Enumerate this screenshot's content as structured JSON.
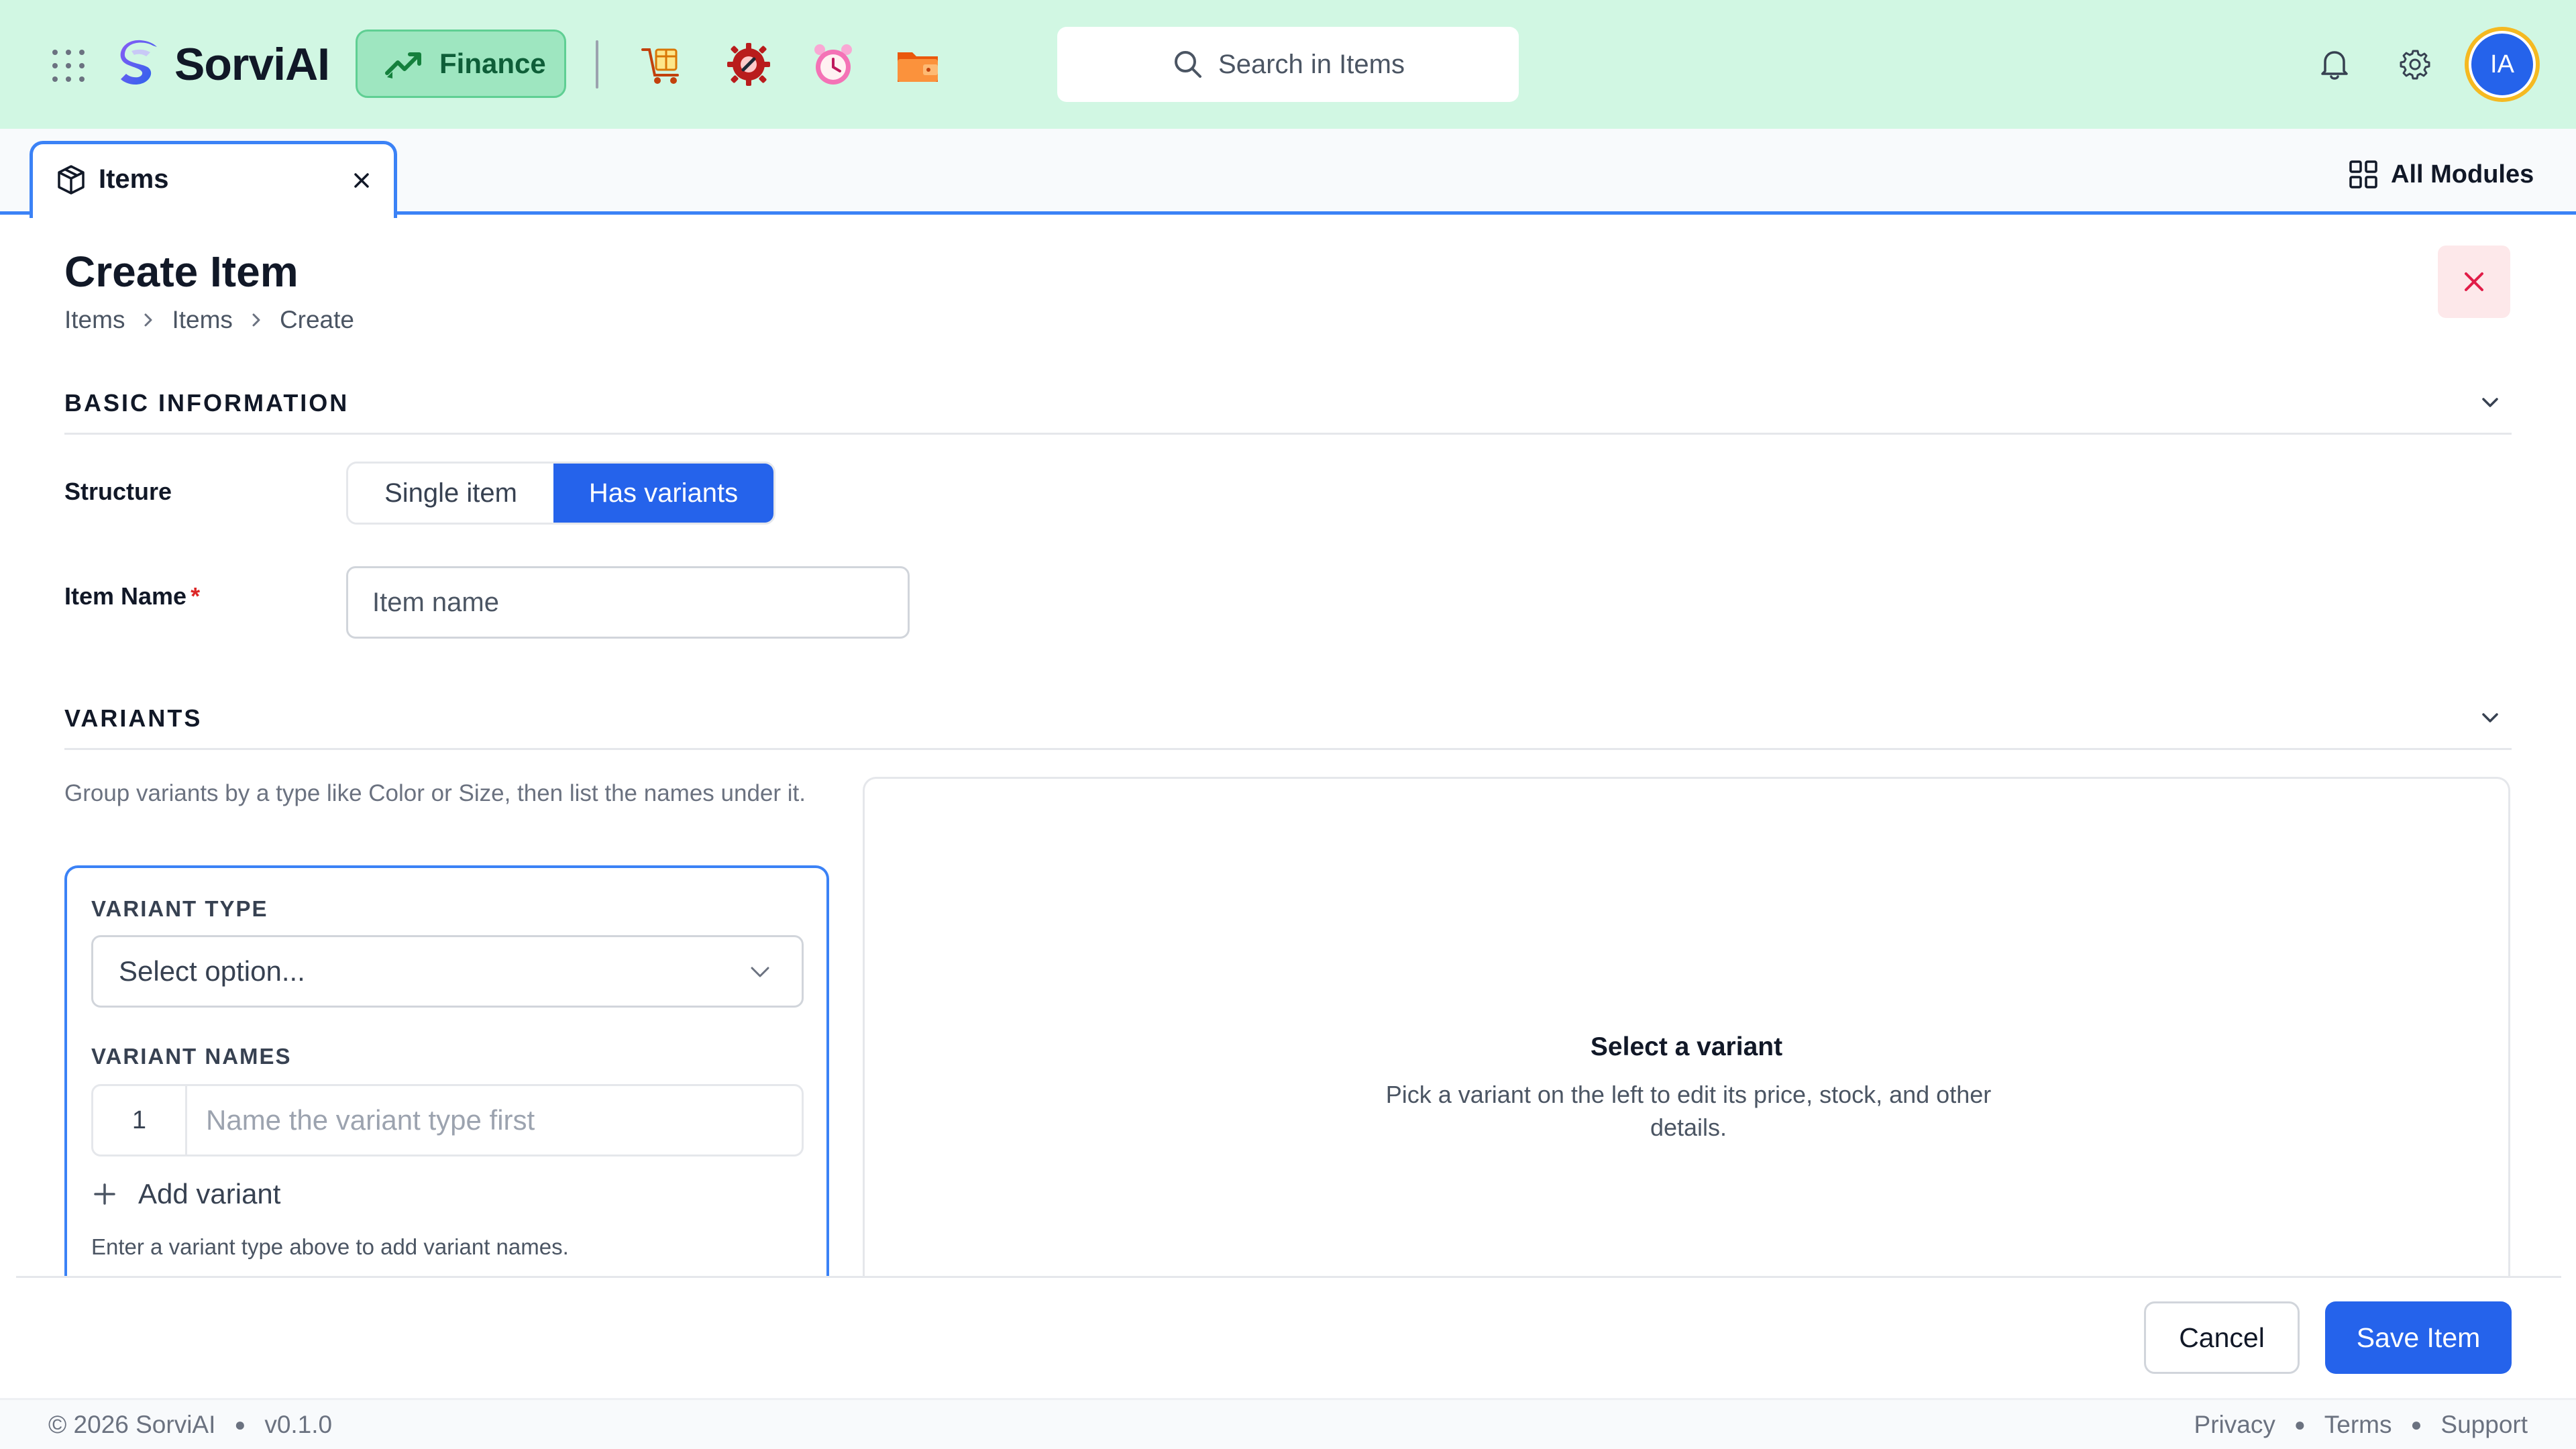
{
  "header": {
    "brand": "SorviAI",
    "module": "Finance",
    "search_placeholder": "Search in Items",
    "avatar_initials": "IA",
    "colors": {
      "bg": "#d1f7e3",
      "chip": "#9ee6c0",
      "accent": "#2563eb",
      "ring": "#f5b921"
    },
    "app_icons": [
      "shopping-cart-box-icon",
      "settings-gear-icon",
      "alarm-clock-icon",
      "wallet-folder-icon"
    ]
  },
  "tabs": {
    "active_label": "Items",
    "all_modules": "All Modules"
  },
  "page": {
    "title": "Create Item",
    "breadcrumb": [
      "Items",
      "Items",
      "Create"
    ]
  },
  "basic": {
    "heading": "BASIC INFORMATION",
    "structure_label": "Structure",
    "structure_options": [
      "Single item",
      "Has variants"
    ],
    "structure_selected": "Has variants",
    "name_label": "Item Name",
    "required_mark": "*",
    "name_placeholder": "Item name"
  },
  "variants": {
    "heading": "VARIANTS",
    "helper": "Group variants by a type like Color or Size, then list the names under it.",
    "type_label": "VARIANT TYPE",
    "type_placeholder": "Select option...",
    "names_label": "VARIANT NAMES",
    "row_number": "1",
    "row_placeholder": "Name the variant type first",
    "add_label": "Add variant",
    "hint": "Enter a variant type above to add variant names.",
    "empty_title": "Select a variant",
    "empty_desc": "Pick a variant on the left to edit its price, stock, and other details."
  },
  "actions": {
    "cancel": "Cancel",
    "save": "Save Item"
  },
  "footer": {
    "copyright": "© 2026 SorviAI",
    "version": "v0.1.0",
    "links": [
      "Privacy",
      "Terms",
      "Support"
    ]
  }
}
